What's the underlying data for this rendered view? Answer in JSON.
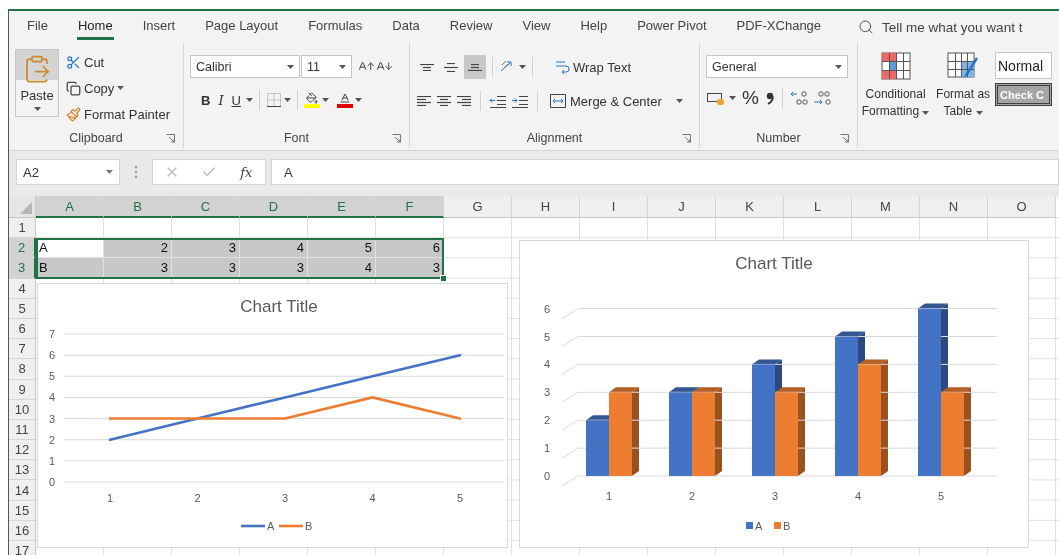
{
  "ribbon": {
    "tabs": [
      {
        "label": "File",
        "selected": false
      },
      {
        "label": "Home",
        "selected": true
      },
      {
        "label": "Insert",
        "selected": false
      },
      {
        "label": "Page Layout",
        "selected": false
      },
      {
        "label": "Formulas",
        "selected": false
      },
      {
        "label": "Data",
        "selected": false
      },
      {
        "label": "Review",
        "selected": false
      },
      {
        "label": "View",
        "selected": false
      },
      {
        "label": "Help",
        "selected": false
      },
      {
        "label": "Power Pivot",
        "selected": false
      },
      {
        "label": "PDF-XChange",
        "selected": false
      }
    ],
    "tell_me": "Tell me what you want t",
    "clipboard": {
      "label": "Clipboard",
      "paste": "Paste",
      "cut": "Cut",
      "copy": "Copy",
      "format_painter": "Format Painter"
    },
    "font": {
      "label": "Font",
      "font_name": "Calibri",
      "font_size": "11",
      "bold": "B",
      "italic": "I",
      "underline": "U"
    },
    "alignment": {
      "label": "Alignment",
      "vertical_align": [
        {
          "selected": false
        },
        {
          "selected": false
        },
        {
          "selected": true
        }
      ],
      "wrap_text": "Wrap Text",
      "merge": "Merge & Center"
    },
    "number": {
      "label": "Number",
      "format": "General",
      "percent": "%"
    },
    "styles": {
      "conditional_formatting": "Conditional Formatting",
      "format_as_table": "Format as Table",
      "cell_styles": [
        {
          "label": "Normal",
          "kind": "normal"
        },
        {
          "label": "Check C",
          "kind": "check"
        }
      ]
    }
  },
  "formula_bar": {
    "name_box": "A2",
    "function_label": "fx",
    "formula": "A"
  },
  "sheet": {
    "columns": [
      {
        "label": "A",
        "selected": true
      },
      {
        "label": "B",
        "selected": true
      },
      {
        "label": "C",
        "selected": true
      },
      {
        "label": "D",
        "selected": true
      },
      {
        "label": "E",
        "selected": true
      },
      {
        "label": "F",
        "selected": true
      },
      {
        "label": "G",
        "selected": false
      },
      {
        "label": "H",
        "selected": false
      },
      {
        "label": "I",
        "selected": false
      },
      {
        "label": "J",
        "selected": false
      },
      {
        "label": "K",
        "selected": false
      },
      {
        "label": "L",
        "selected": false
      },
      {
        "label": "M",
        "selected": false
      },
      {
        "label": "N",
        "selected": false
      },
      {
        "label": "O",
        "selected": false
      }
    ],
    "rows": [
      {
        "label": "1",
        "selected": false
      },
      {
        "label": "2",
        "selected": true,
        "cells": [
          {
            "value": "A",
            "selected": false
          },
          {
            "value": "2",
            "selected": true
          },
          {
            "value": "3",
            "selected": true
          },
          {
            "value": "4",
            "selected": true
          },
          {
            "value": "5",
            "selected": true
          },
          {
            "value": "6",
            "selected": true
          }
        ]
      },
      {
        "label": "3",
        "selected": true,
        "cells": [
          {
            "value": "B",
            "selected": true
          },
          {
            "value": "3",
            "selected": true
          },
          {
            "value": "3",
            "selected": true
          },
          {
            "value": "3",
            "selected": true
          },
          {
            "value": "4",
            "selected": true
          },
          {
            "value": "3",
            "selected": true
          }
        ]
      },
      {
        "label": "4",
        "selected": false
      },
      {
        "label": "5",
        "selected": false
      },
      {
        "label": "6",
        "selected": false
      },
      {
        "label": "7",
        "selected": false
      },
      {
        "label": "8",
        "selected": false
      },
      {
        "label": "9",
        "selected": false
      },
      {
        "label": "10",
        "selected": false
      },
      {
        "label": "11",
        "selected": false
      },
      {
        "label": "12",
        "selected": false
      },
      {
        "label": "13",
        "selected": false
      },
      {
        "label": "14",
        "selected": false
      },
      {
        "label": "15",
        "selected": false
      },
      {
        "label": "16",
        "selected": false
      },
      {
        "label": "17",
        "selected": false
      }
    ]
  },
  "charts": [
    {
      "chart_data": {
        "type": "line",
        "title": "Chart Title",
        "grid": true,
        "legend": "bottom",
        "categories": [
          "1",
          "2",
          "3",
          "4",
          "5"
        ],
        "ylim": [
          0,
          7
        ],
        "yticks": [
          0,
          1,
          2,
          3,
          4,
          5,
          6,
          7
        ],
        "series": [
          {
            "name": "A",
            "color": "#4472c4",
            "values": [
              2,
              3,
              4,
              5,
              6
            ]
          },
          {
            "name": "B",
            "color": "#ed7d31",
            "values": [
              3,
              3,
              3,
              4,
              3
            ]
          }
        ]
      }
    },
    {
      "chart_data": {
        "type": "bar",
        "title": "Chart Title",
        "grid": true,
        "legend": "bottom",
        "categories": [
          "1",
          "2",
          "3",
          "4",
          "5"
        ],
        "ylim": [
          0,
          6
        ],
        "yticks": [
          0,
          1,
          2,
          3,
          4,
          5,
          6
        ],
        "series": [
          {
            "name": "A",
            "color": "#4472c4",
            "values": [
              2,
              3,
              4,
              5,
              6
            ]
          },
          {
            "name": "B",
            "color": "#ed7d31",
            "values": [
              3,
              3,
              3,
              4,
              3
            ]
          }
        ]
      }
    }
  ]
}
